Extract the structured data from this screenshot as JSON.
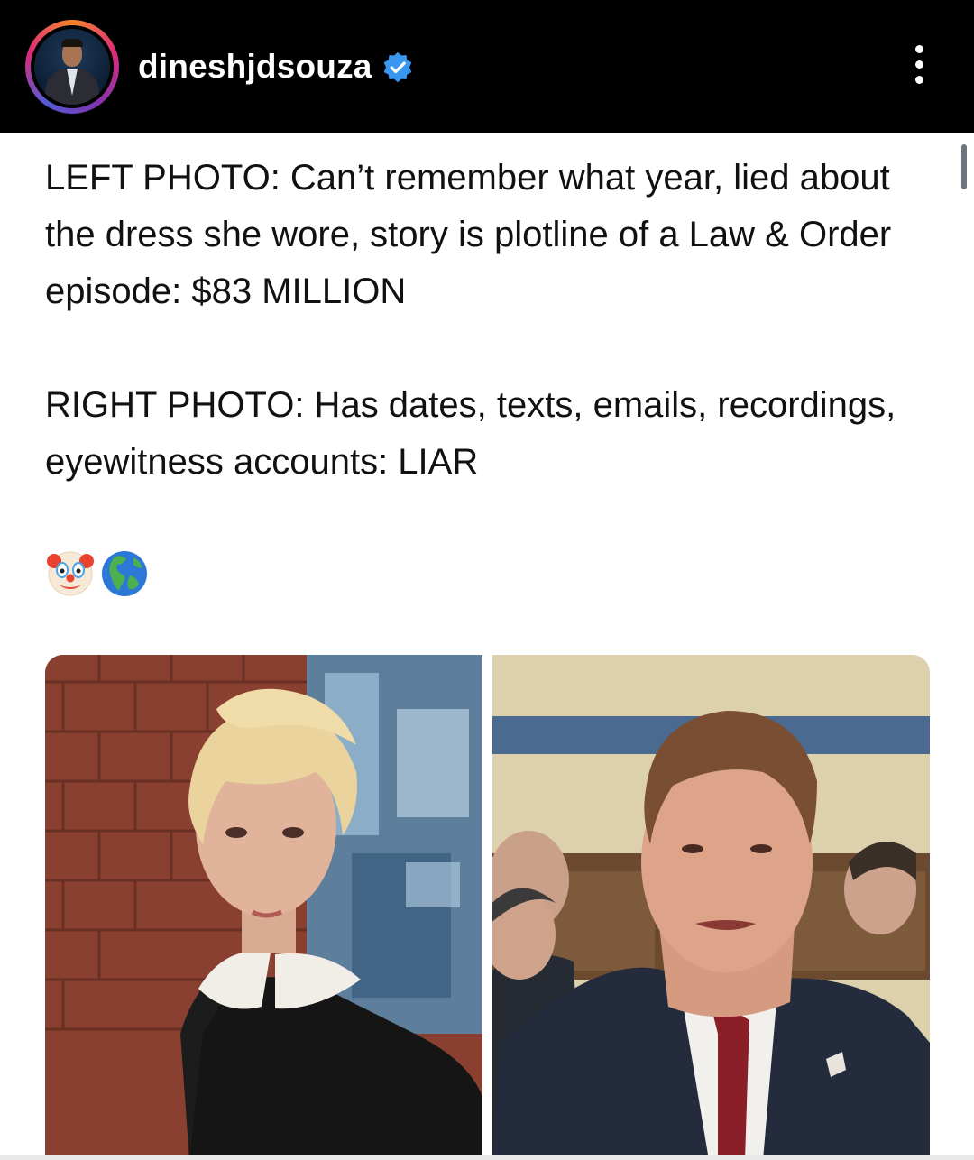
{
  "header": {
    "username": "dineshjdsouza",
    "verified": true,
    "avatar_icon": "profile-photo",
    "more_icon": "more-vertical-icon"
  },
  "post": {
    "paragraph_1": "LEFT PHOTO: Can’t remember what year, lied about the dress she wore, story is plotline of a Law & Order episode: $83 MILLION",
    "paragraph_2": "RIGHT PHOTO: Has dates, texts, emails, recordings, eyewitness accounts: LIAR",
    "emojis": [
      "clown-face-emoji",
      "globe-americas-emoji"
    ]
  },
  "media": {
    "left_photo": "woman-with-short-blonde-hair-in-black-top",
    "right_photo": "man-in-suit-at-hearing"
  },
  "colors": {
    "header_bg": "#000000",
    "verified_blue": "#3897f0",
    "text": "#111111",
    "background": "#ffffff"
  }
}
